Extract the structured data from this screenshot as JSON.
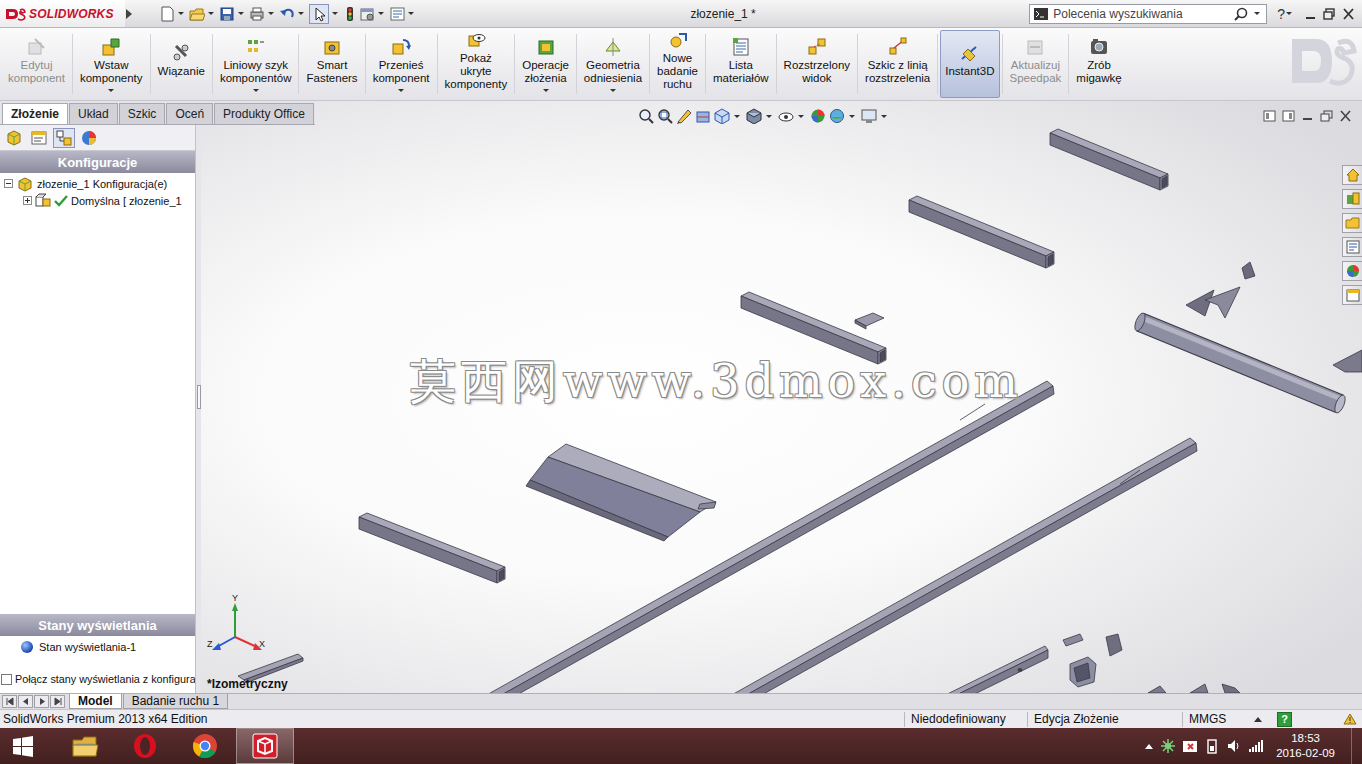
{
  "titlebar": {
    "logo": "SOLIDWORKS",
    "title": "złozenie_1 *",
    "search": {
      "placeholder": "Polecenia wyszukiwania"
    },
    "help": "?"
  },
  "ribbon": [
    {
      "lines": [
        "Edytuj",
        "komponent"
      ],
      "disabled": true,
      "selected": false,
      "dropdown": false
    },
    {
      "lines": [
        "Wstaw",
        "komponenty"
      ],
      "disabled": false,
      "selected": false,
      "dropdown": true
    },
    {
      "lines": [
        "Wiązanie"
      ],
      "disabled": false,
      "selected": false,
      "dropdown": false
    },
    {
      "lines": [
        "Liniowy szyk",
        "komponentów"
      ],
      "disabled": false,
      "selected": false,
      "dropdown": true
    },
    {
      "lines": [
        "Smart",
        "Fasteners"
      ],
      "disabled": false,
      "selected": false,
      "dropdown": false
    },
    {
      "lines": [
        "Przenieś",
        "komponent"
      ],
      "disabled": false,
      "selected": false,
      "dropdown": true
    },
    {
      "lines": [
        "Pokaż",
        "ukryte",
        "komponenty"
      ],
      "disabled": false,
      "selected": false,
      "dropdown": false
    },
    {
      "lines": [
        "Operacje",
        "złożenia"
      ],
      "disabled": false,
      "selected": false,
      "dropdown": true
    },
    {
      "lines": [
        "Geometria",
        "odniesienia"
      ],
      "disabled": false,
      "selected": false,
      "dropdown": true
    },
    {
      "lines": [
        "Nowe",
        "badanie",
        "ruchu"
      ],
      "disabled": false,
      "selected": false,
      "dropdown": false
    },
    {
      "lines": [
        "Lista",
        "materiałów"
      ],
      "disabled": false,
      "selected": false,
      "dropdown": false
    },
    {
      "lines": [
        "Rozstrzelony",
        "widok"
      ],
      "disabled": false,
      "selected": false,
      "dropdown": false
    },
    {
      "lines": [
        "Szkic z linią",
        "rozstrzelenia"
      ],
      "disabled": false,
      "selected": false,
      "dropdown": false
    },
    {
      "lines": [
        "Instant3D"
      ],
      "disabled": false,
      "selected": true,
      "dropdown": false
    },
    {
      "lines": [
        "Aktualizuj",
        "Speedpak"
      ],
      "disabled": true,
      "selected": false,
      "dropdown": false
    },
    {
      "lines": [
        "Zrób",
        "migawkę"
      ],
      "disabled": false,
      "selected": false,
      "dropdown": false
    }
  ],
  "command_tabs": [
    {
      "label": "Złożenie",
      "selected": true
    },
    {
      "label": "Układ",
      "selected": false
    },
    {
      "label": "Szkic",
      "selected": false
    },
    {
      "label": "Oceń",
      "selected": false
    },
    {
      "label": "Produkty Office",
      "selected": false
    }
  ],
  "manager_tabs": [
    {
      "kind": "feature",
      "selected": false
    },
    {
      "kind": "property",
      "selected": false
    },
    {
      "kind": "configuration",
      "selected": true
    },
    {
      "kind": "display",
      "selected": false
    }
  ],
  "configurations": {
    "title": "Konfiguracje",
    "tree": [
      {
        "label": "złozenie_1 Konfiguracja(e)",
        "expanded": true,
        "children": [
          {
            "label": "Domyślna [ złozenie_1",
            "expanded": false,
            "active": true
          }
        ]
      }
    ]
  },
  "display_states": {
    "title": "Stany wyświetlania",
    "items": [
      {
        "label": "Stan wyświetlania-1"
      }
    ],
    "link_option": {
      "label": "Połącz stany wyświetlania z konfigura",
      "checked": false
    }
  },
  "viewport": {
    "watermark": "莫西网www.3dmox.com",
    "view_label": "*Izometryczny",
    "triad": {
      "y": "Y",
      "x": "X",
      "z": "Z"
    }
  },
  "bottom_tabs": [
    {
      "label": "Model",
      "selected": true
    },
    {
      "label": "Badanie ruchu 1",
      "selected": false
    }
  ],
  "status_bar": {
    "product": "SolidWorks Premium 2013 x64 Edition",
    "items": [
      "Niedodefiniowany",
      "Edycja Złożenie",
      "MMGS"
    ],
    "help": "?"
  },
  "taskbar": {
    "apps": [
      {
        "kind": "explorer",
        "active": false
      },
      {
        "kind": "opera",
        "active": false
      },
      {
        "kind": "chrome",
        "active": false
      },
      {
        "kind": "solidworks",
        "active": true
      }
    ],
    "time": "18:53",
    "date": "2016-02-09"
  }
}
